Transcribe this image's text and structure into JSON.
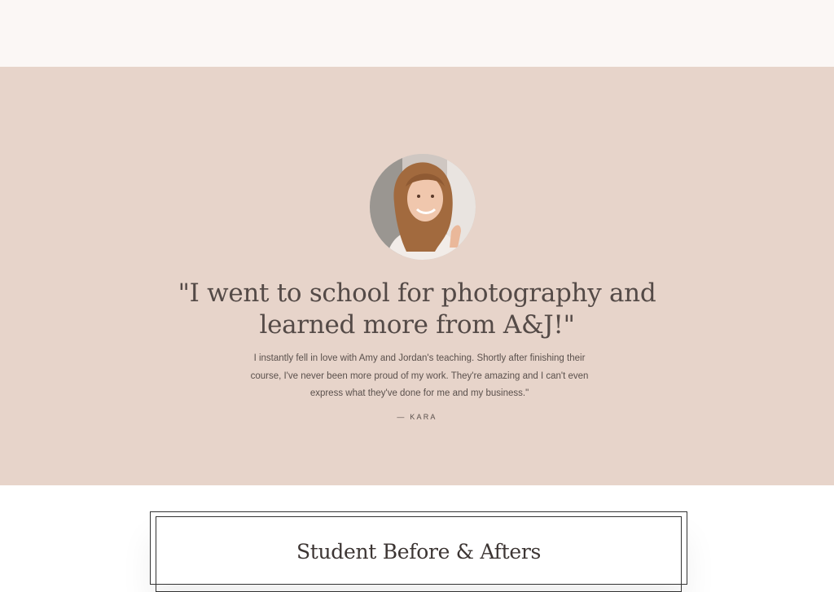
{
  "testimonial": {
    "quote": "\"I went to school for photography and learned more from A&J!\"",
    "body": "I instantly fell in love with Amy and Jordan's teaching. Shortly after finishing their course, I've never been more proud of my work. They're amazing and I can't even express what they've done for me and my business.\"",
    "author": "— KARA",
    "avatar_icon": "portrait-photo"
  },
  "before_after": {
    "title": "Student Before & Afters"
  },
  "colors": {
    "top_band": "#fbf7f5",
    "testimonial_bg": "#e7d4ca",
    "quote_text": "#544a47"
  }
}
